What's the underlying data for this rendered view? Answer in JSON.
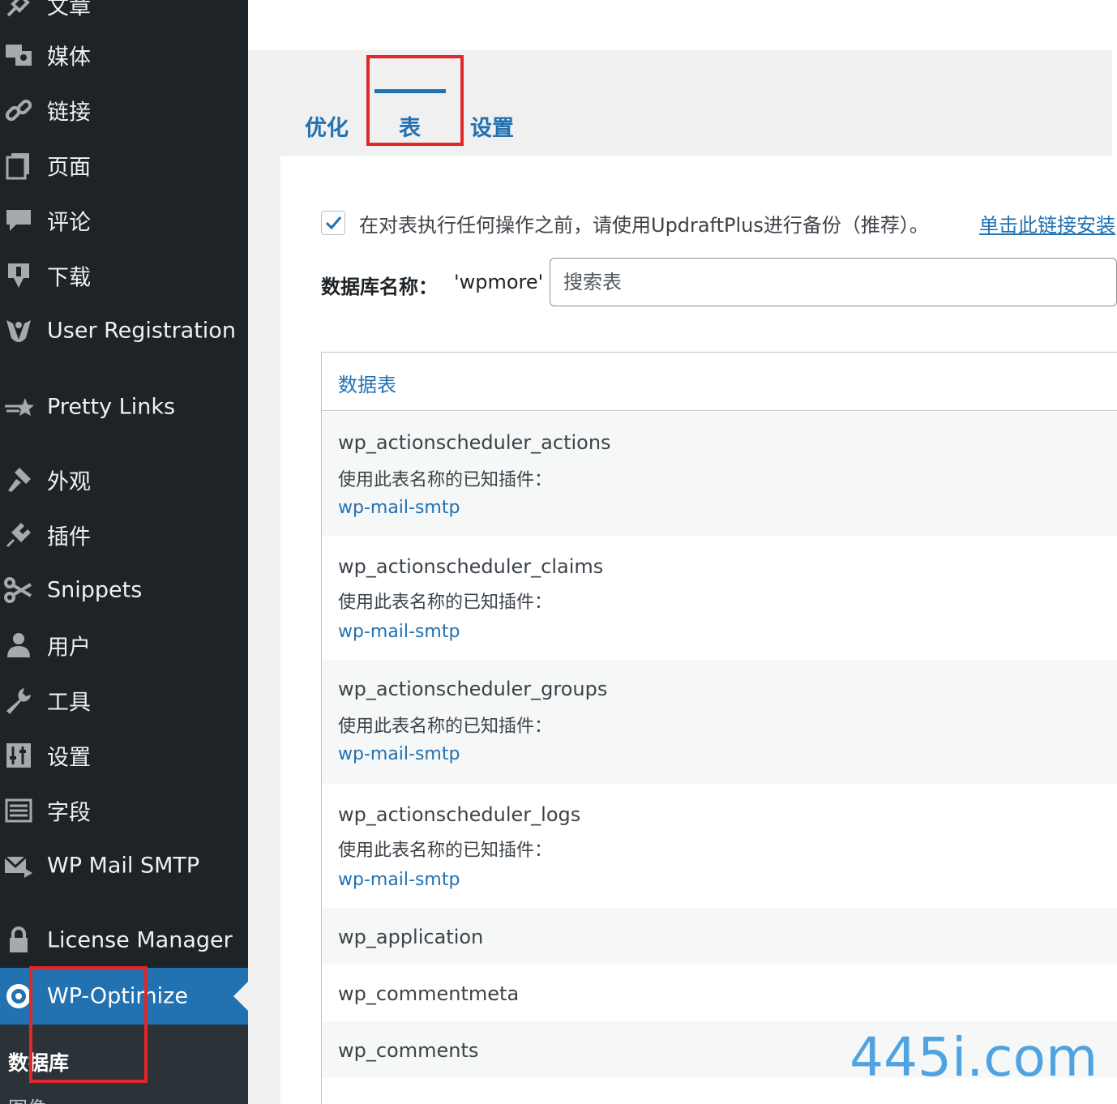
{
  "sidebar": {
    "items": [
      {
        "label": "文章",
        "icon": "pin-icon"
      },
      {
        "label": "媒体",
        "icon": "media-icon"
      },
      {
        "label": "链接",
        "icon": "link-icon"
      },
      {
        "label": "页面",
        "icon": "page-icon"
      },
      {
        "label": "评论",
        "icon": "comment-icon"
      },
      {
        "label": "下载",
        "icon": "download-icon"
      },
      {
        "label": "User Registration",
        "icon": "user-registration-icon"
      },
      {
        "label": "Pretty Links",
        "icon": "star-icon"
      },
      {
        "label": "外观",
        "icon": "appearance-icon"
      },
      {
        "label": "插件",
        "icon": "plugin-icon"
      },
      {
        "label": "Snippets",
        "icon": "scissors-icon"
      },
      {
        "label": "用户",
        "icon": "user-icon"
      },
      {
        "label": "工具",
        "icon": "wrench-icon"
      },
      {
        "label": "设置",
        "icon": "settings-icon"
      },
      {
        "label": "字段",
        "icon": "fields-icon"
      },
      {
        "label": "WP Mail SMTP",
        "icon": "mail-icon"
      },
      {
        "label": "License Manager",
        "icon": "lock-icon"
      },
      {
        "label": "WP-Optimize",
        "icon": "optimize-icon",
        "active": true
      }
    ],
    "submenu": {
      "current": "数据库",
      "next": "图像"
    }
  },
  "tabs": {
    "optimize": "优化",
    "tables": "表",
    "settings": "设置",
    "active": "表"
  },
  "notice": {
    "checked": true,
    "text": "在对表执行任何操作之前，请使用UpdraftPlus进行备份（推荐）。",
    "link": "单击此链接安装"
  },
  "database": {
    "label": "数据库名称：",
    "name": "'wpmore'"
  },
  "search": {
    "placeholder": "搜索表"
  },
  "table": {
    "header": "数据表",
    "known_plugins_label": "使用此表名称的已知插件：",
    "rows": [
      {
        "name": "wp_actionscheduler_actions",
        "plugin": "wp-mail-smtp"
      },
      {
        "name": "wp_actionscheduler_claims",
        "plugin": "wp-mail-smtp"
      },
      {
        "name": "wp_actionscheduler_groups",
        "plugin": "wp-mail-smtp"
      },
      {
        "name": "wp_actionscheduler_logs",
        "plugin": "wp-mail-smtp"
      },
      {
        "name": "wp_application"
      },
      {
        "name": "wp_commentmeta"
      },
      {
        "name": "wp_comments"
      }
    ]
  },
  "watermark": "445i.com",
  "colors": {
    "sidebar_bg": "#1d2327",
    "accent": "#2271b1",
    "highlight_box": "#e0282a",
    "content_bg": "#f0f0f1"
  }
}
